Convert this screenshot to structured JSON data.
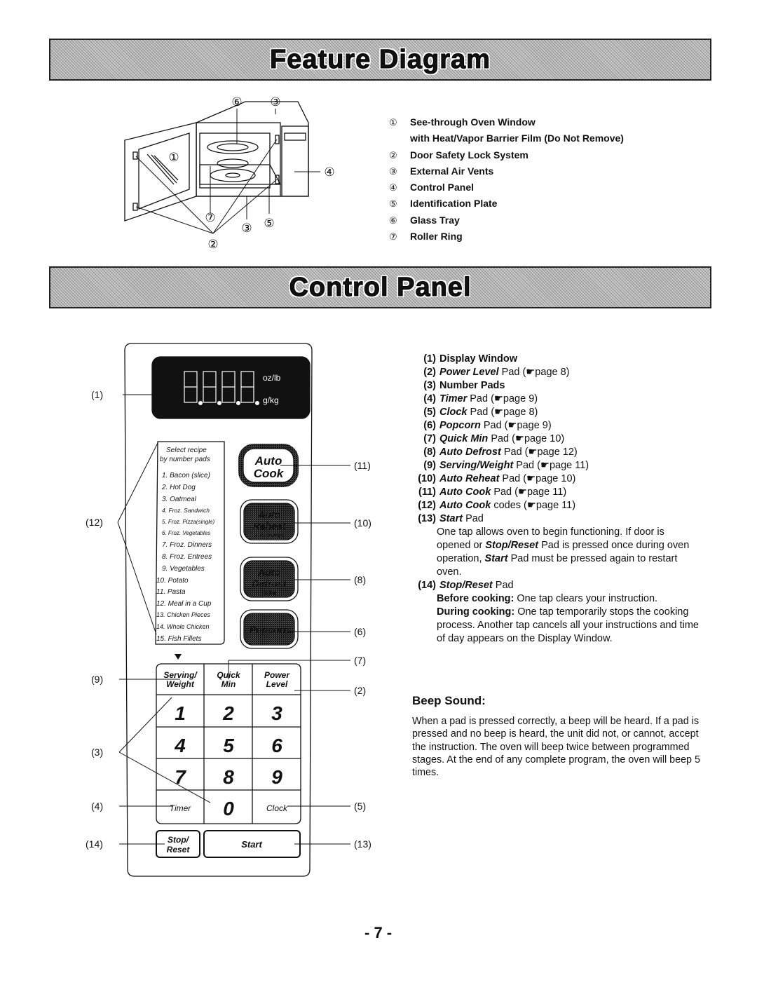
{
  "feature_diagram": {
    "title": "Feature Diagram",
    "callout_numbers": [
      "①",
      "②",
      "③",
      "④",
      "⑤",
      "⑥",
      "⑦"
    ],
    "legend": [
      {
        "num": "①",
        "label": "See-through Oven Window",
        "label2": "with Heat/Vapor Barrier Film (Do Not Remove)"
      },
      {
        "num": "②",
        "label": "Door Safety Lock System"
      },
      {
        "num": "③",
        "label": "External Air Vents"
      },
      {
        "num": "④",
        "label": "Control Panel"
      },
      {
        "num": "⑤",
        "label": "Identification Plate"
      },
      {
        "num": "⑥",
        "label": "Glass Tray"
      },
      {
        "num": "⑦",
        "label": "Roller Ring"
      }
    ]
  },
  "control_panel": {
    "title": "Control Panel",
    "display": {
      "unit_top": "oz/lb",
      "unit_bottom": "g/kg",
      "digits": "8888"
    },
    "recipe_list": {
      "heading1": "Select recipe",
      "heading2": "by number pads",
      "items": [
        "1. Bacon (slice)",
        "2. Hot Dog",
        "3. Oatmeal",
        "4. Froz. Sandwich",
        "5. Froz. Pizza(single)",
        "6. Froz. Vegetables",
        "7. Froz. Dinners",
        "8. Froz. Entrees",
        "9. Vegetables",
        "10. Potato",
        "11. Pasta",
        "12. Meal in a Cup",
        "13. Chicken Pieces",
        "14. Whole Chicken",
        "15. Fish Fillets"
      ]
    },
    "pads": {
      "auto_cook": [
        "Auto",
        "Cook"
      ],
      "auto_reheat": [
        "Auto",
        "Reheat",
        "1-4 servings"
      ],
      "auto_defrost": [
        "Auto",
        "Defrost",
        "(lb/kg)"
      ],
      "popcorn": "Popcorn",
      "serving_weight": [
        "Serving/",
        "Weight"
      ],
      "quick_min": [
        "Quick",
        "Min"
      ],
      "power_level": [
        "Power",
        "Level"
      ],
      "digits": [
        "1",
        "2",
        "3",
        "4",
        "5",
        "6",
        "7",
        "8",
        "9",
        "0"
      ],
      "timer": "Timer",
      "clock": "Clock",
      "stop_reset": [
        "Stop/",
        "Reset"
      ],
      "start": "Start"
    },
    "callouts": {
      "c1": "(1)",
      "c2": "(2)",
      "c3": "(3)",
      "c4": "(4)",
      "c5": "(5)",
      "c6": "(6)",
      "c7": "(7)",
      "c8": "(8)",
      "c9": "(9)",
      "c10": "(10)",
      "c11": "(11)",
      "c12": "(12)",
      "c13": "(13)",
      "c14": "(14)"
    },
    "legend": [
      {
        "n": "(1)",
        "bold": "Display Window",
        "italic": "",
        "rest": ""
      },
      {
        "n": "(2)",
        "bold": "",
        "italic": "Power Level",
        "rest": " Pad (☛page 8)"
      },
      {
        "n": "(3)",
        "bold": "Number Pads",
        "italic": "",
        "rest": ""
      },
      {
        "n": "(4)",
        "bold": "",
        "italic": "Timer",
        "rest": " Pad (☛page 9)"
      },
      {
        "n": "(5)",
        "bold": "",
        "italic": "Clock",
        "rest": " Pad (☛page 8)"
      },
      {
        "n": "(6)",
        "bold": "",
        "italic": "Popcorn",
        "rest": " Pad (☛page 9)"
      },
      {
        "n": "(7)",
        "bold": "",
        "italic": "Quick Min",
        "rest": " Pad (☛page 10)"
      },
      {
        "n": "(8)",
        "bold": "",
        "italic": "Auto Defrost",
        "rest": " Pad (☛page 12)"
      },
      {
        "n": "(9)",
        "bold": "",
        "italic": "Serving/Weight",
        "rest": " Pad (☛page 11)"
      },
      {
        "n": "(10)",
        "bold": "",
        "italic": "Auto Reheat",
        "rest": " Pad (☛page 10)"
      },
      {
        "n": "(11)",
        "bold": "",
        "italic": "Auto Cook",
        "rest": " Pad (☛page 11)"
      },
      {
        "n": "(12)",
        "bold": "",
        "italic": "Auto Cook",
        "rest": " codes (☛page 11)"
      },
      {
        "n": "(13)",
        "bold": "",
        "italic": "Start",
        "rest": " Pad"
      }
    ],
    "start_desc": {
      "t1": "One tap allows oven to begin functioning. If door is opened or ",
      "t2": "Stop/Reset",
      "t3": " Pad is pressed once during oven operation, ",
      "t4": "Start",
      "t5": " Pad must be pressed again to restart oven."
    },
    "stop_item": {
      "n": "(14)",
      "italic": "Stop/Reset",
      "rest": " Pad"
    },
    "stop_desc": {
      "before_label": "Before cooking:",
      "before_text": " One tap clears your instruction.",
      "during_label": "During cooking:",
      "during_text": " One tap temporarily stops the cooking process. Another tap cancels all your instructions and time of day appears on the Display Window."
    }
  },
  "beep": {
    "title": "Beep Sound:",
    "body": "When a pad is pressed correctly, a beep will be heard. If a pad is pressed and no beep is heard, the unit did not, or cannot, accept the instruction.  The oven will beep twice between programmed stages.  At the end of any complete program, the oven will beep 5 times."
  },
  "page_number": "- 7 -"
}
